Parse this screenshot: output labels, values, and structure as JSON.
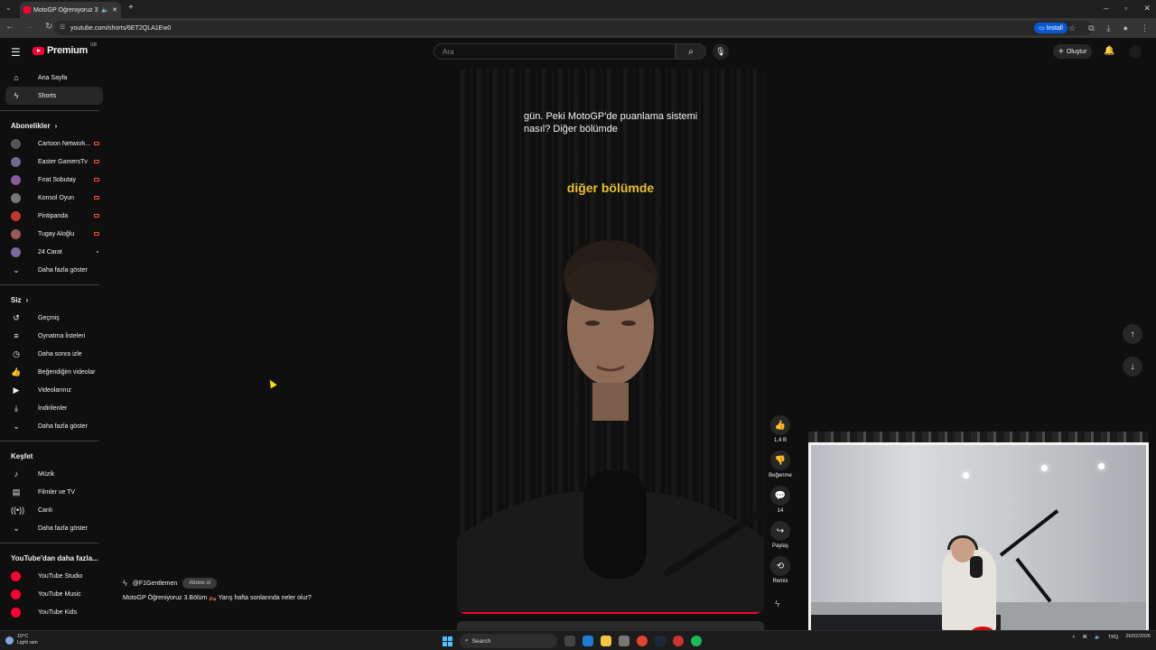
{
  "browser": {
    "tab_title": "MotoGP Öğreniyoruz 3.Bö",
    "url": "youtube.com/shorts/6ET2QLA1Ew0",
    "install_label": "Install"
  },
  "header": {
    "logo_text": "Premium",
    "country_code": "GB",
    "search_placeholder": "Ara",
    "create_label": "Oluştur"
  },
  "sidebar": {
    "main": [
      {
        "label": "Ana Sayfa",
        "icon": "home-icon"
      },
      {
        "label": "Shorts",
        "icon": "shorts-icon"
      }
    ],
    "subscriptions_title": "Abonelikler",
    "subscriptions": [
      {
        "label": "Cartoon Network...",
        "color": "#555555",
        "badge": "live"
      },
      {
        "label": "Easter GamersTv",
        "color": "#6b6b8a",
        "badge": "live"
      },
      {
        "label": "Fırat Sobutay",
        "color": "#8a5a9a",
        "badge": "live"
      },
      {
        "label": "Konsol Oyun",
        "color": "#777777",
        "badge": "live"
      },
      {
        "label": "Pintipanda",
        "color": "#c0392b",
        "badge": "live"
      },
      {
        "label": "Tugay Aloğlu",
        "color": "#9a5a5a",
        "badge": "live"
      },
      {
        "label": "24 Carat",
        "color": "#7a6aa0",
        "badge": "dot"
      }
    ],
    "show_more_1": "Daha fazla göster",
    "you_title": "Siz",
    "you_items": [
      {
        "label": "Geçmiş",
        "icon": "history-icon"
      },
      {
        "label": "Oynatma listeleri",
        "icon": "playlist-icon"
      },
      {
        "label": "Daha sonra izle",
        "icon": "clock-icon"
      },
      {
        "label": "Beğendiğim videolar",
        "icon": "thumbs-up-icon"
      },
      {
        "label": "Videolarınız",
        "icon": "video-icon"
      },
      {
        "label": "İndirilenler",
        "icon": "download-icon"
      }
    ],
    "show_more_2": "Daha fazla göster",
    "explore_title": "Keşfet",
    "explore_items": [
      {
        "label": "Müzik",
        "icon": "music-icon"
      },
      {
        "label": "Filmler ve TV",
        "icon": "film-icon"
      },
      {
        "label": "Canlı",
        "icon": "live-icon"
      }
    ],
    "show_more_3": "Daha fazla göster",
    "more_title": "YouTube'dan daha fazla...",
    "more_items": [
      {
        "label": "YouTube Studio"
      },
      {
        "label": "YouTube Music"
      },
      {
        "label": "YouTube Kids"
      }
    ]
  },
  "video": {
    "caption": "gün. Peki MotoGP'de puanlama sistemi nasıl? Diğer bölümde",
    "highlight": "diğer bölümde",
    "channel": "@F1Gentlemen",
    "subscribe_label": "Abone ol",
    "title": "MotoGP Öğreniyoruz 3.Bölüm 🏍️ Yarış hafta sonlarında neler olur?",
    "progress": 0.995
  },
  "actions": {
    "like_count": "1,4 B",
    "dislike_label": "Beğenme",
    "comment_count": "14",
    "share_label": "Paylaş",
    "remix_label": "Remix"
  },
  "taskbar": {
    "temp": "10°C",
    "weather": "Light rain",
    "search_label": "Search",
    "lang": "TRQ",
    "date": "26/02/2026"
  }
}
